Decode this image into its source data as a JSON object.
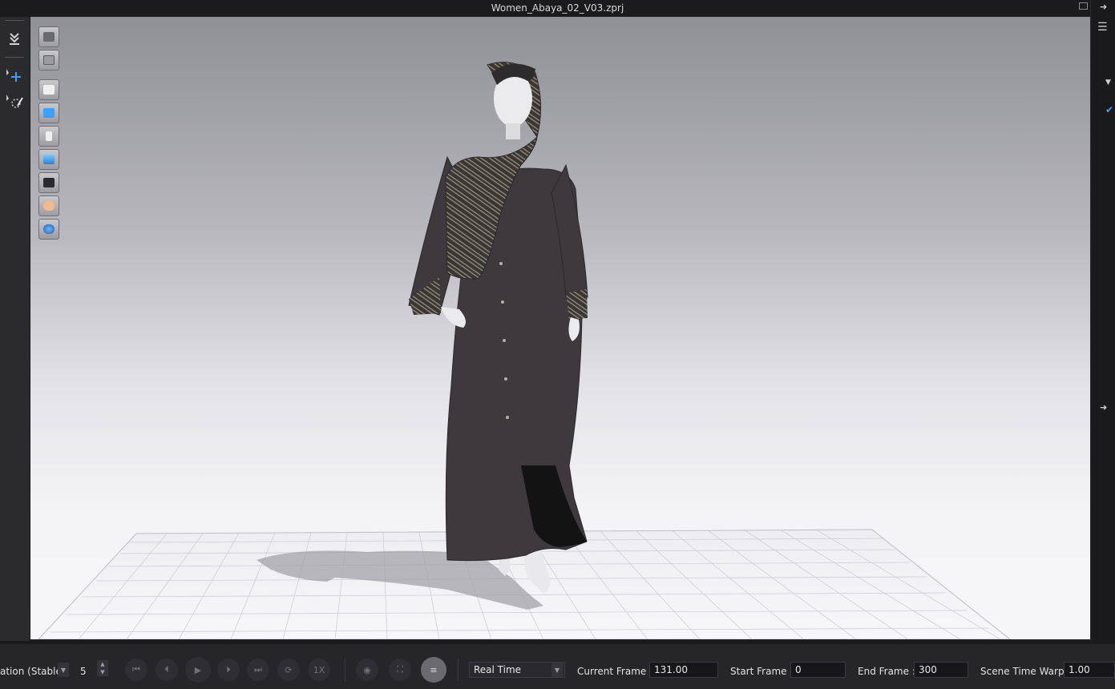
{
  "window": {
    "title": "Women_Abaya_02_V03.zprj"
  },
  "left_toolbar": [
    {
      "name": "import-avatar-icon"
    },
    {
      "name": "select-move-icon"
    },
    {
      "name": "edit-pattern-icon"
    }
  ],
  "viewport_toolbar": [
    "show-garment-icon",
    "show-fabric-icon",
    "show-3d-garment-icon",
    "show-pattern-icon",
    "show-avatar-icon",
    "show-texture-icon",
    "show-shadow-icon",
    "show-skin-icon",
    "show-environment-icon"
  ],
  "bottom_bar": {
    "simulation_label": "ation (Stable",
    "step_value": "5",
    "playback_mode": "Real Time",
    "current_frame_label": "Current Frame :",
    "current_frame_value": "131.00",
    "start_frame_label": "Start Frame :",
    "start_frame_value": "0",
    "end_frame_label": "End Frame :",
    "end_frame_value": "300",
    "time_warp_label": "Scene Time Warp",
    "time_warp_value": "1.00",
    "speed_label": "1X"
  },
  "colors": {
    "garment": "#3d393c",
    "scarf_pattern": "#8b8270",
    "mannequin": "#e8e8ea",
    "accent_blue": "#3aa0ff"
  }
}
